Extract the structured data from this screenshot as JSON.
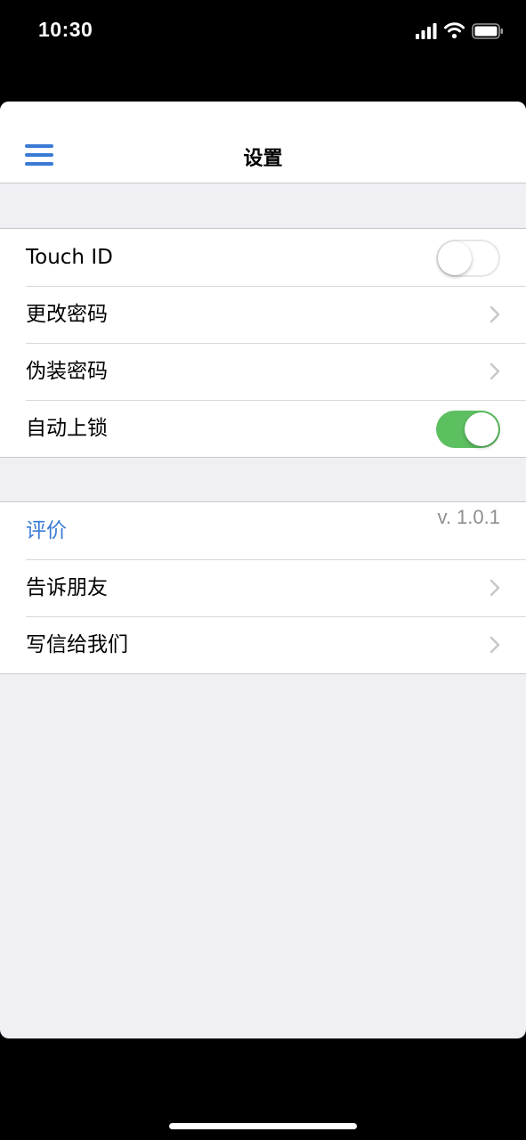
{
  "status_bar": {
    "time": "10:30"
  },
  "nav": {
    "title": "设置"
  },
  "security_group": {
    "touch_id": {
      "label": "Touch ID",
      "enabled": false
    },
    "change_password": {
      "label": "更改密码"
    },
    "fake_password": {
      "label": "伪装密码"
    },
    "auto_lock": {
      "label": "自动上锁",
      "enabled": true
    }
  },
  "about_group": {
    "rate": {
      "label": "评价"
    },
    "version": "v. 1.0.1",
    "tell_friends": {
      "label": "告诉朋友"
    },
    "write_us": {
      "label": "写信给我们"
    }
  },
  "colors": {
    "accent": "#3a7bd5",
    "toggle_on": "#5cbf60",
    "background": "#efeff4"
  }
}
